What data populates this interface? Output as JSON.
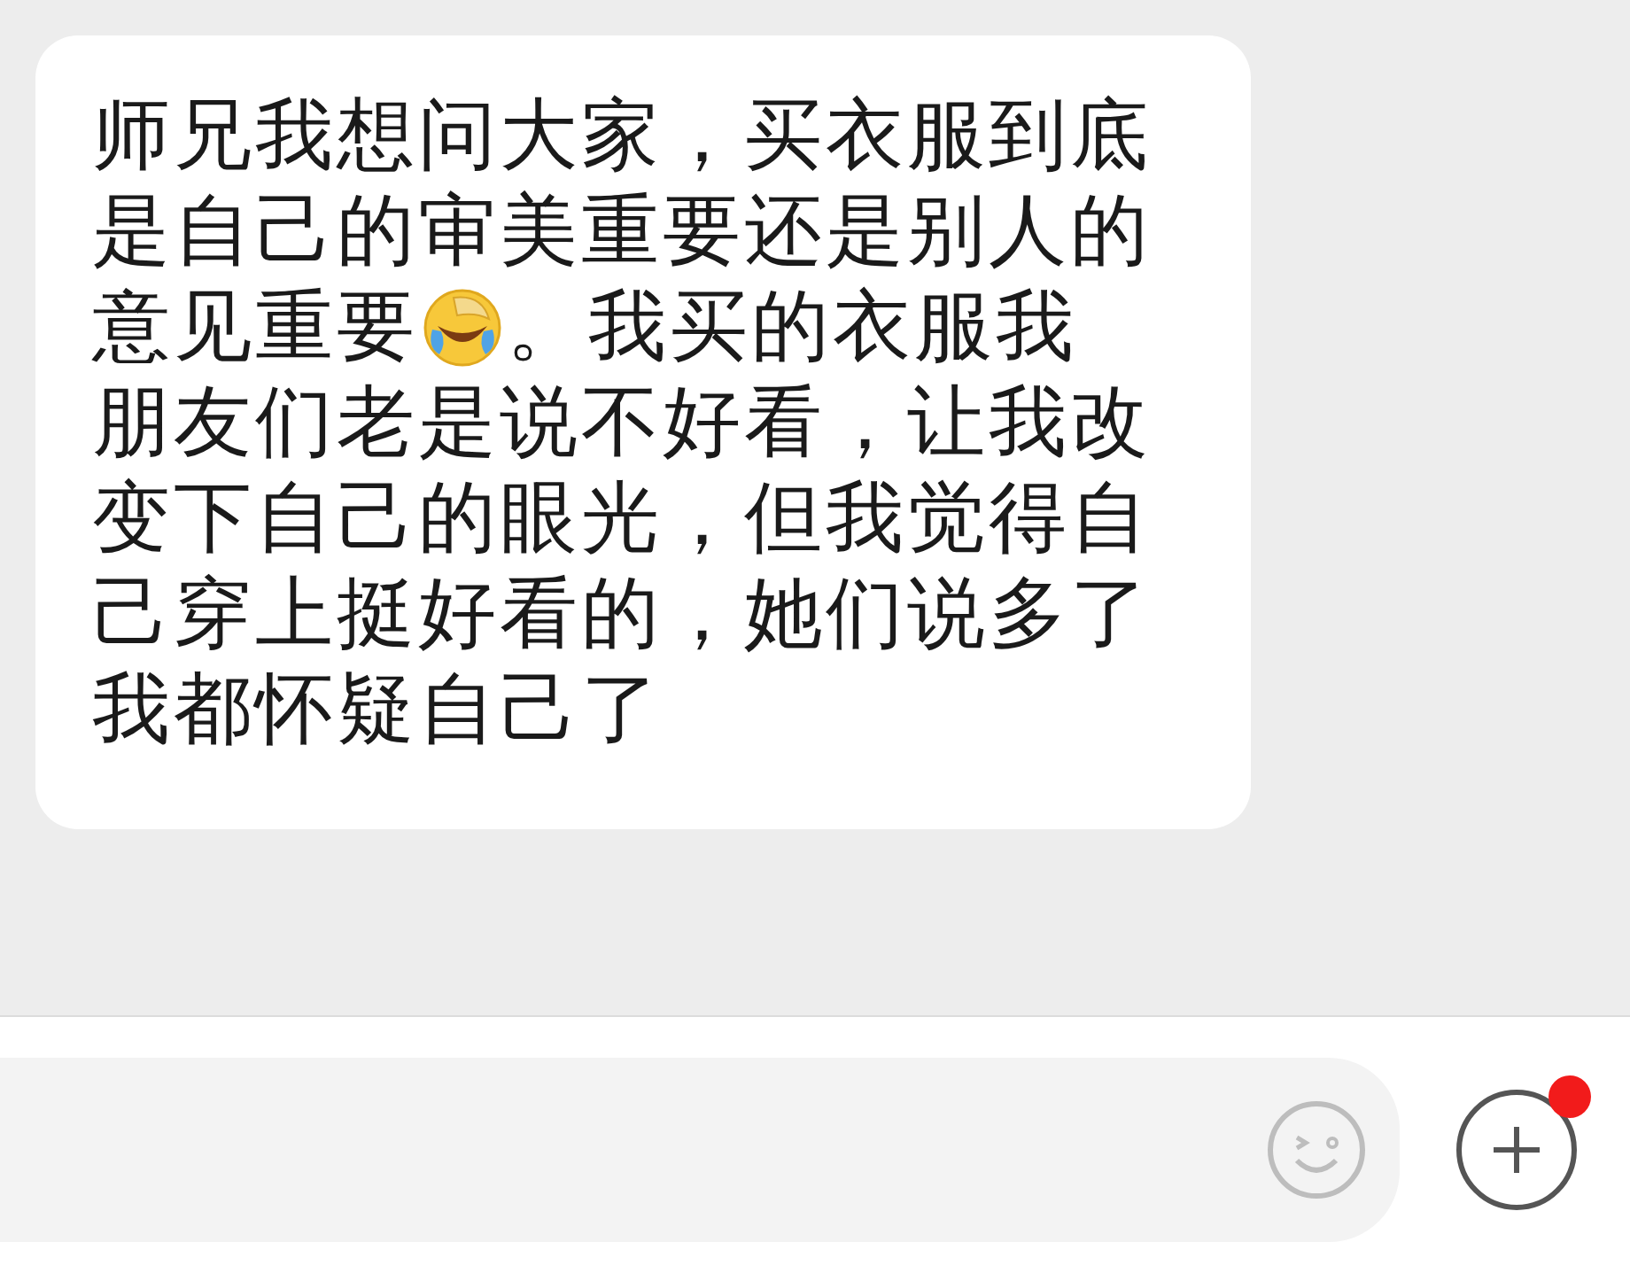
{
  "message": {
    "lines": [
      {
        "parts": [
          {
            "kind": "text",
            "text": "师兄我想问大家，买衣服到底"
          }
        ]
      },
      {
        "parts": [
          {
            "kind": "text",
            "text": "是自己的审美重要还是别人的"
          }
        ]
      },
      {
        "parts": [
          {
            "kind": "text",
            "text": "意见重要"
          },
          {
            "kind": "emoji"
          },
          {
            "kind": "text",
            "text": "。我买的衣服我"
          }
        ]
      },
      {
        "parts": [
          {
            "kind": "text",
            "text": "朋友们老是说不好看，让我改"
          }
        ]
      },
      {
        "parts": [
          {
            "kind": "text",
            "text": "变下自己的眼光，但我觉得自"
          }
        ]
      },
      {
        "parts": [
          {
            "kind": "text",
            "text": "己穿上挺好看的，她们说多了"
          }
        ]
      },
      {
        "parts": [
          {
            "kind": "text",
            "text": "我都怀疑自己了"
          }
        ]
      }
    ]
  },
  "input_bar": {
    "plus_has_notification": true
  }
}
